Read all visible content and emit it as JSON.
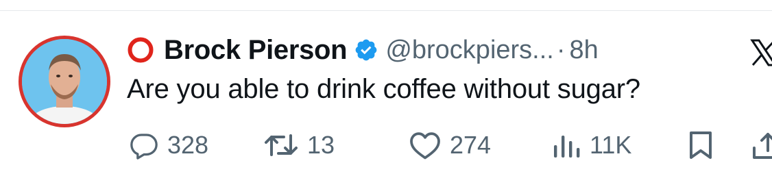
{
  "tweet": {
    "author_name": "Brock Pierson",
    "handle": "@brockpiers...",
    "separator": "·",
    "time": "8h",
    "text": "Are you able to drink coffee without sugar?"
  },
  "actions": {
    "replies": "328",
    "retweets": "13",
    "likes": "274",
    "views": "11K"
  },
  "colors": {
    "verified": "#1d9bf0",
    "avatar_ring": "#d8342e",
    "name_emoji_ring": "#e0241b",
    "muted": "#536471"
  },
  "icons": [
    "red-circle-emoji-icon",
    "verified-badge-icon",
    "x-logo-icon",
    "reply-icon",
    "retweet-icon",
    "like-icon",
    "views-icon",
    "bookmark-icon",
    "share-icon"
  ]
}
